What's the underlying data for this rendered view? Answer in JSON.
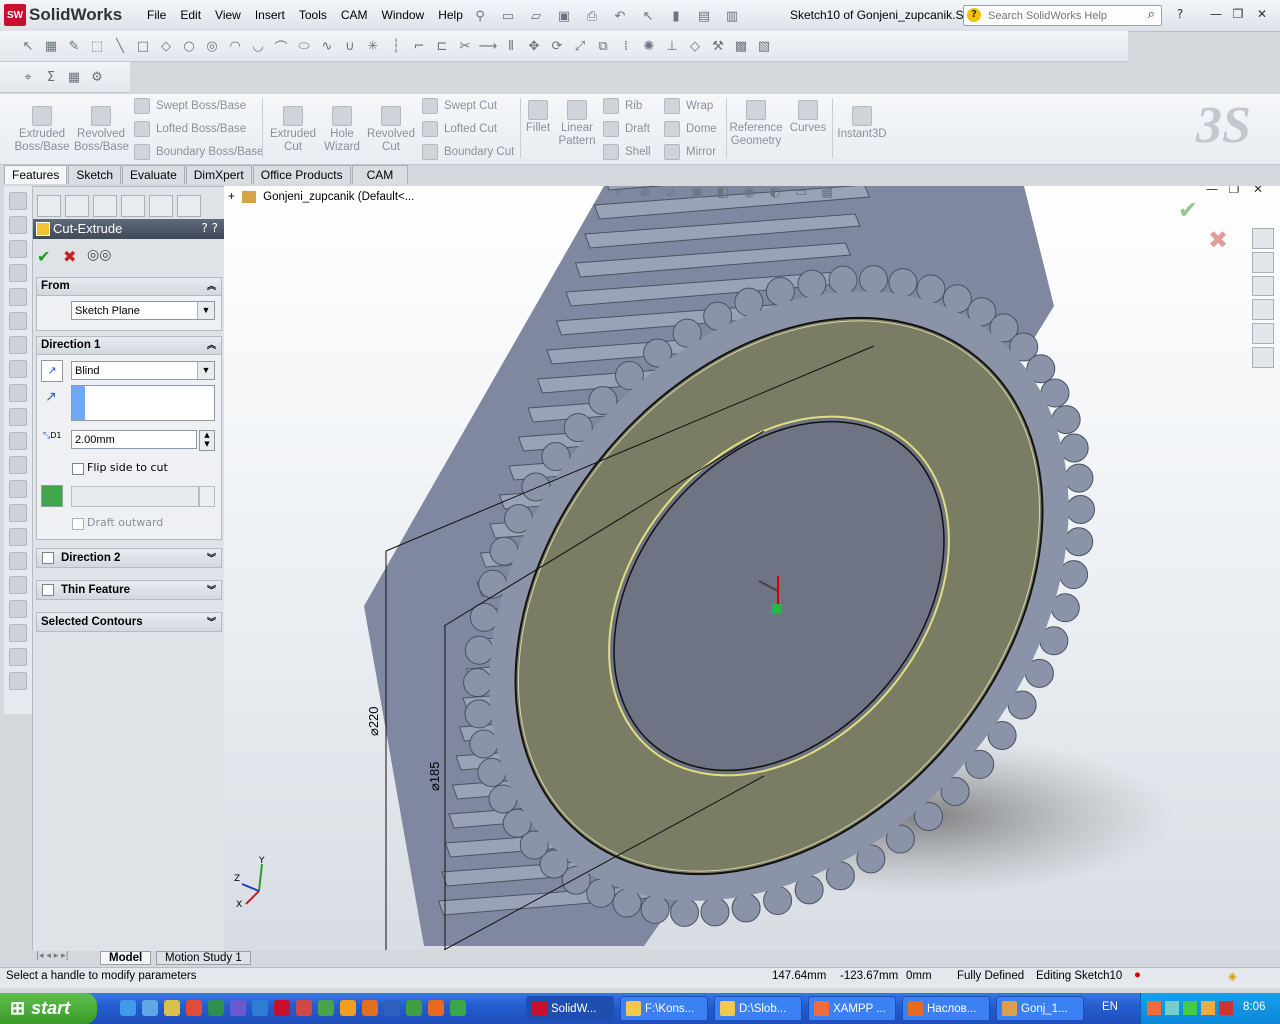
{
  "app": {
    "brand": "SolidWorks",
    "logo_text": "SW",
    "doc_title": "Sketch10 of Gonjeni_zupcanik.S..."
  },
  "menu": [
    "File",
    "Edit",
    "View",
    "Insert",
    "Tools",
    "CAM",
    "Window",
    "Help"
  ],
  "search": {
    "placeholder": "Search SolidWorks Help",
    "help": "?"
  },
  "command_manager": {
    "extruded_boss": "Extruded\nBoss/Base",
    "revolved_boss": "Revolved\nBoss/Base",
    "swept_boss": "Swept Boss/Base",
    "lofted_boss": "Lofted Boss/Base",
    "boundary_boss": "Boundary Boss/Base",
    "extruded_cut": "Extruded\nCut",
    "hole_wizard": "Hole\nWizard",
    "revolved_cut": "Revolved\nCut",
    "swept_cut": "Swept Cut",
    "lofted_cut": "Lofted Cut",
    "boundary_cut": "Boundary Cut",
    "fillet": "Fillet",
    "linear_pattern": "Linear\nPattern",
    "rib": "Rib",
    "draft": "Draft",
    "shell": "Shell",
    "wrap": "Wrap",
    "dome": "Dome",
    "mirror": "Mirror",
    "reference_geometry": "Reference\nGeometry",
    "curves": "Curves",
    "instant3d": "Instant3D"
  },
  "tabs": [
    "Features",
    "Sketch",
    "Evaluate",
    "DimXpert",
    "Office Products",
    "CAM"
  ],
  "property_manager": {
    "title": "Cut-Extrude",
    "help": "? ?",
    "from_label": "From",
    "from_value": "Sketch Plane",
    "dir1_label": "Direction 1",
    "end_condition": "Blind",
    "depth": "2.00mm",
    "depth_icon_label": "D1",
    "flip_side": "Flip side to cut",
    "draft_outward": "Draft outward",
    "dir2_label": "Direction 2",
    "thin_label": "Thin Feature",
    "contours_label": "Selected Contours"
  },
  "tree": {
    "item": "Gonjeni_zupcanik  (Default<..."
  },
  "dimensions": {
    "d1": "⌀220",
    "d2": "⌀185"
  },
  "triad": {
    "x": "X",
    "y": "Y",
    "z": "Z"
  },
  "bottom_tabs": [
    "Model",
    "Motion Study 1"
  ],
  "status": {
    "hint": "Select a handle to modify parameters",
    "x": "147.64mm",
    "y": "-123.67mm",
    "z": "0mm",
    "state": "Fully Defined",
    "mode": "Editing Sketch10"
  },
  "taskbar": {
    "start": "start",
    "buttons": [
      "SolidW...",
      "F:\\Kons...",
      "D:\\Slob...",
      "XAMPP ...",
      "Наслов...",
      "Gonj_1..."
    ],
    "lang": "EN",
    "time": "8:06"
  },
  "colors": {
    "gear_teeth": "#8a93a8",
    "face": "#7a7d66",
    "hub": "#6f7685",
    "accent": "#c8102e"
  }
}
